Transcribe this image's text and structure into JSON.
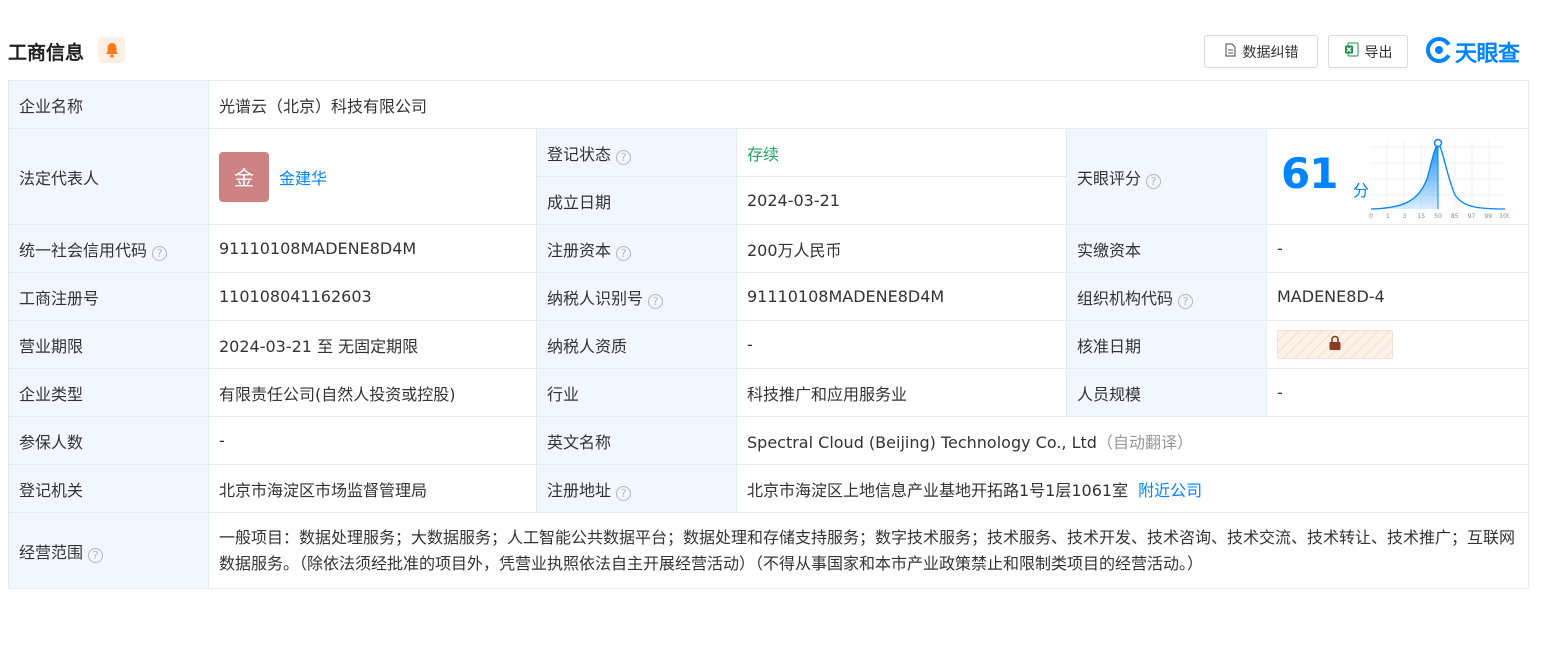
{
  "header": {
    "title": "工商信息",
    "correct_label": "数据纠错",
    "export_label": "导出",
    "brand": "天眼查"
  },
  "company": {
    "name_label": "企业名称",
    "name": "光谱云（北京）科技有限公司",
    "legal_rep_label": "法定代表人",
    "legal_rep_avatar": "金",
    "legal_rep_name": "金建华",
    "reg_status_label": "登记状态",
    "reg_status": "存续",
    "found_date_label": "成立日期",
    "found_date": "2024-03-21",
    "score_label": "天眼评分",
    "score": "61",
    "score_unit": "分",
    "score_ticks": [
      "0",
      "1",
      "3",
      "15",
      "50",
      "85",
      "97",
      "99",
      "100"
    ],
    "credit_code_label": "统一社会信用代码",
    "credit_code": "91110108MADENE8D4M",
    "reg_capital_label": "注册资本",
    "reg_capital": "200万人民币",
    "paid_capital_label": "实缴资本",
    "paid_capital": "-",
    "reg_no_label": "工商注册号",
    "reg_no": "110108041162603",
    "taxpayer_id_label": "纳税人识别号",
    "taxpayer_id": "91110108MADENE8D4M",
    "org_code_label": "组织机构代码",
    "org_code": "MADENE8D-4",
    "term_label": "营业期限",
    "term": "2024-03-21 至 无固定期限",
    "tax_qual_label": "纳税人资质",
    "tax_qual": "-",
    "approve_date_label": "核准日期",
    "type_label": "企业类型",
    "type": "有限责任公司(自然人投资或控股)",
    "industry_label": "行业",
    "industry": "科技推广和应用服务业",
    "staff_size_label": "人员规模",
    "staff_size": "-",
    "insured_label": "参保人数",
    "insured": "-",
    "english_name_label": "英文名称",
    "english_name": "Spectral Cloud (Beijing) Technology Co., Ltd",
    "english_name_hint": "（自动翻译）",
    "authority_label": "登记机关",
    "authority": "北京市海淀区市场监督管理局",
    "address_label": "注册地址",
    "address": "北京市海淀区上地信息产业基地开拓路1号1层1061室",
    "nearby_link": "附近公司",
    "scope_label": "经营范围",
    "scope": "一般项目：数据处理服务；大数据服务；人工智能公共数据平台；数据处理和存储支持服务；数字技术服务；技术服务、技术开发、技术咨询、技术交流、技术转让、技术推广；互联网数据服务。（除依法须经批准的项目外，凭营业执照依法自主开展经营活动）（不得从事国家和本市产业政策禁止和限制类项目的经营活动。）"
  },
  "colors": {
    "accent": "#0084ff",
    "status_green": "#1fa461",
    "label_bg": "#f1f6ff",
    "avatar_bg": "#cd8384"
  },
  "icons": [
    "bell-icon",
    "document-icon",
    "excel-icon",
    "tianyancha-logo-icon",
    "question-icon",
    "lock-icon"
  ]
}
